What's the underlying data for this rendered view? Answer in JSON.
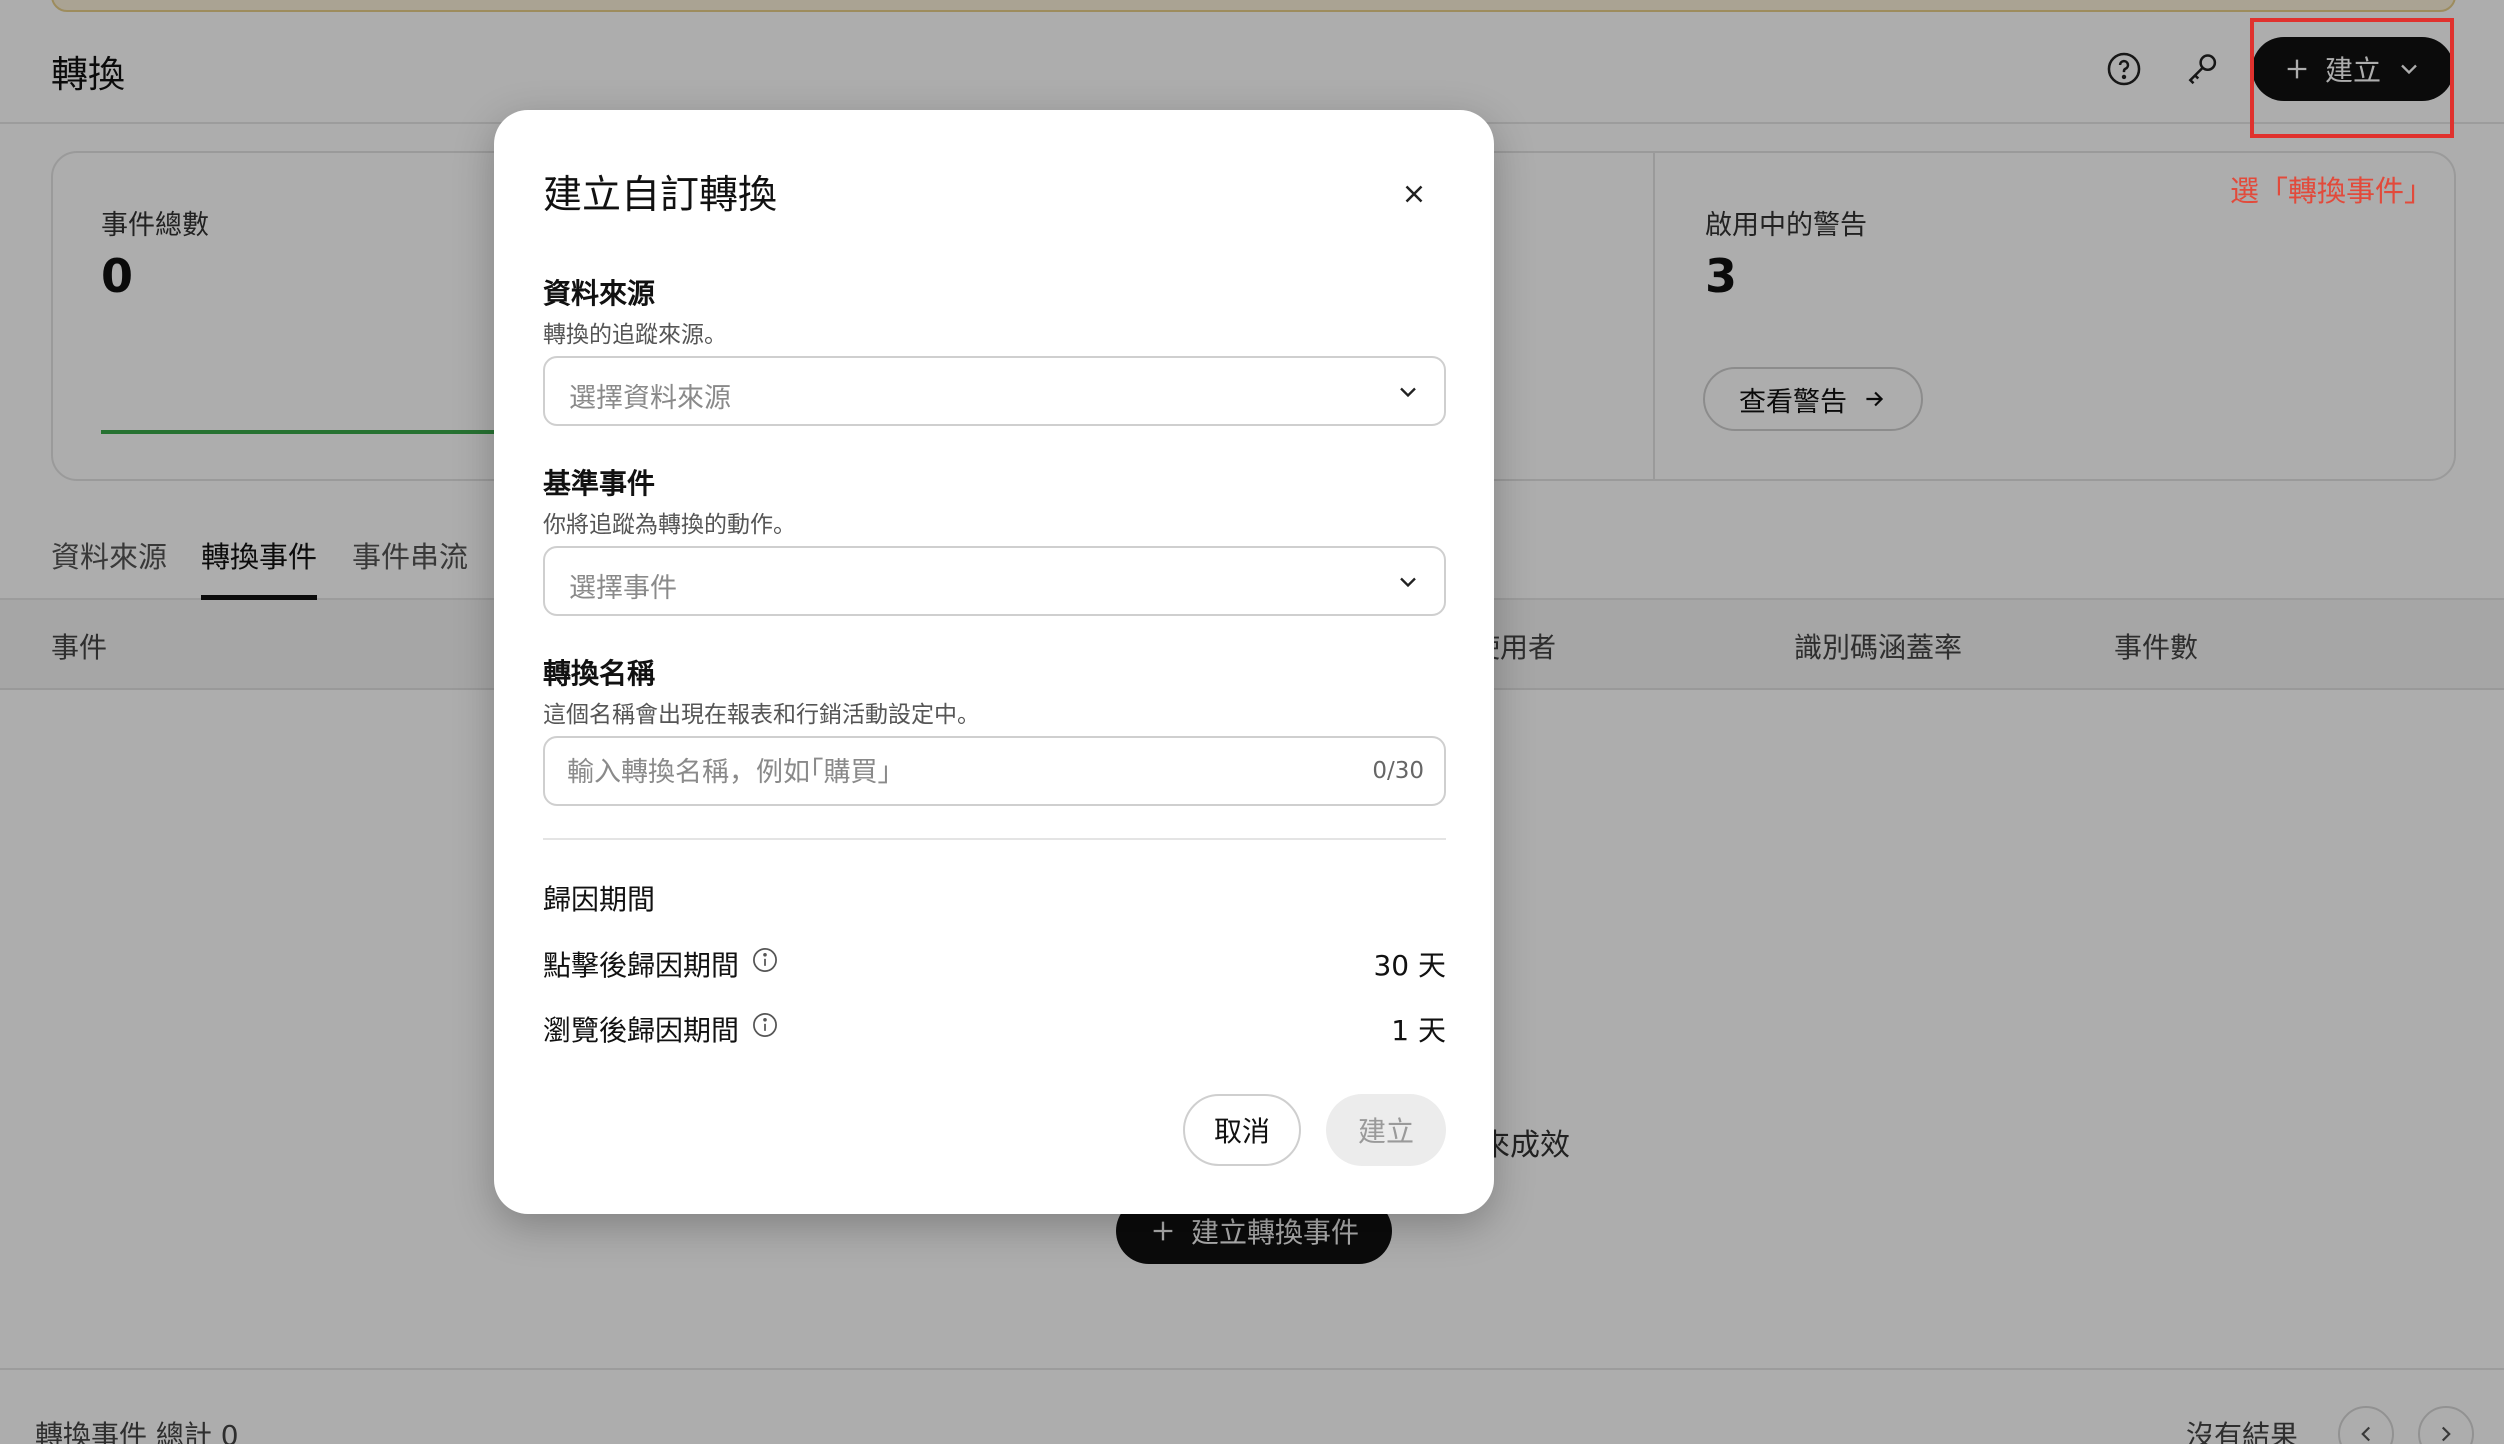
{
  "header": {
    "title": "轉換",
    "create_label": "建立"
  },
  "annotation": {
    "text": "選「轉換事件」",
    "color": "#e0322e"
  },
  "stats": {
    "total_label": "事件總數",
    "total_value": "0",
    "alerts_label": "啟用中的警告",
    "alerts_value": "3",
    "view_alerts_label": "查看警告"
  },
  "tabs": [
    {
      "label": "資料來源",
      "active": false
    },
    {
      "label": "轉換事件",
      "active": true
    },
    {
      "label": "事件串流",
      "active": false
    }
  ],
  "table": {
    "columns": [
      "事件",
      "使用者",
      "識別碼涵蓋率",
      "事件數"
    ],
    "empty_text": "來成效",
    "empty_create_label": "建立轉換事件"
  },
  "footer": {
    "total": "轉換事件 總計 0",
    "no_results": "沒有結果"
  },
  "modal": {
    "title": "建立自訂轉換",
    "data_source": {
      "label": "資料來源",
      "help": "轉換的追蹤來源。",
      "placeholder": "選擇資料來源"
    },
    "base_event": {
      "label": "基準事件",
      "help": "你將追蹤為轉換的動作。",
      "placeholder": "選擇事件"
    },
    "conversion_name": {
      "label": "轉換名稱",
      "help": "這個名稱會出現在報表和行銷活動設定中。",
      "placeholder": "輸入轉換名稱，例如｢購買｣",
      "counter": "0/30"
    },
    "attribution": {
      "section_label": "歸因期間",
      "click_label": "點擊後歸因期間",
      "click_value": "30 天",
      "view_label": "瀏覽後歸因期間",
      "view_value": "1 天"
    },
    "cancel_label": "取消",
    "create_label": "建立"
  }
}
